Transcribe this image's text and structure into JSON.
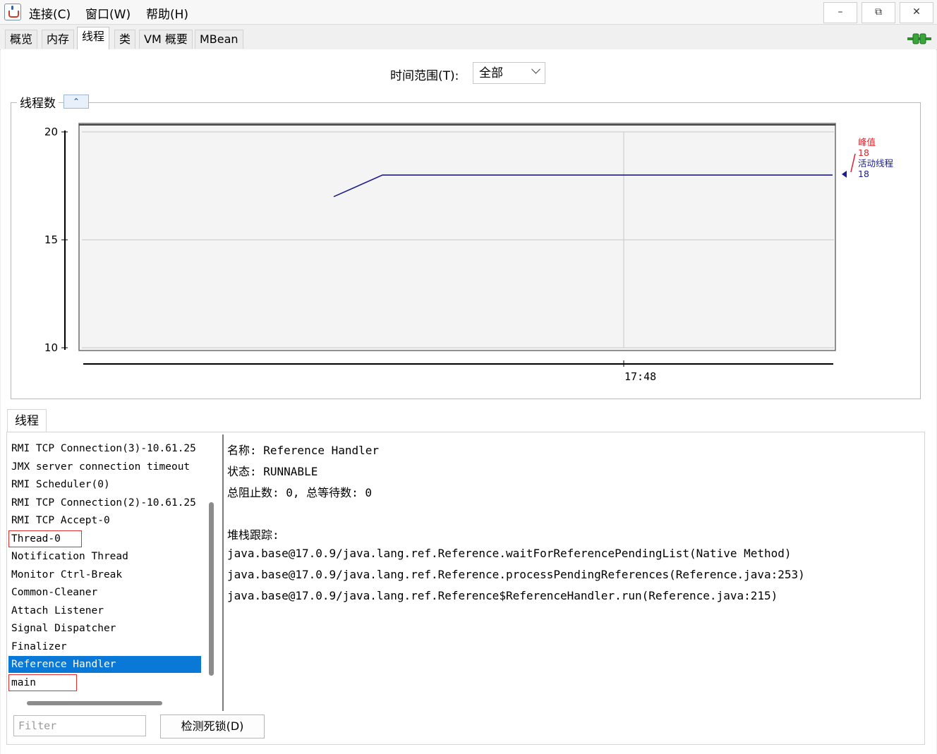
{
  "menu": {
    "connect": "连接(C)",
    "window": "窗口(W)",
    "help": "帮助(H)"
  },
  "window_buttons": {
    "minimize": "–",
    "restore": "⧉",
    "close": "✕"
  },
  "tabs": [
    {
      "label": "概览"
    },
    {
      "label": "内存"
    },
    {
      "label": "线程",
      "active": true
    },
    {
      "label": "类"
    },
    {
      "label": "VM 概要"
    },
    {
      "label": "MBean"
    }
  ],
  "time_range": {
    "label": "时间范围(T):",
    "value": "全部"
  },
  "chart_title": "线程数",
  "collapse_glyph": "⌃",
  "chart_data": {
    "type": "line",
    "y_ticks": [
      "20",
      "15",
      "10"
    ],
    "ylim": [
      10,
      20
    ],
    "x_ticks": [
      "17:48"
    ],
    "series": [
      {
        "name": "活动线程",
        "color": "#1c1c8c",
        "points": [
          [
            0,
            17
          ],
          [
            1,
            18
          ],
          [
            2,
            18
          ],
          [
            3,
            18
          ]
        ]
      }
    ],
    "legend": [
      {
        "label": "峰值",
        "value": "18",
        "color": "#e0202a"
      },
      {
        "label": "活动线程",
        "value": "18",
        "color": "#1c1c8c"
      }
    ]
  },
  "threads_tab_label": "线程",
  "threads": [
    "RMI TCP Connection(3)-10.61.25",
    "JMX server connection timeout",
    "RMI Scheduler(0)",
    "RMI TCP Connection(2)-10.61.25",
    "RMI TCP Accept-0",
    "Thread-0",
    "Notification Thread",
    "Monitor Ctrl-Break",
    "Common-Cleaner",
    "Attach Listener",
    "Signal Dispatcher",
    "Finalizer",
    "Reference Handler",
    "main"
  ],
  "selected_thread": "Reference Handler",
  "details": {
    "name": "名称: Reference Handler",
    "state": "状态: RUNNABLE",
    "counts": "总阻止数: 0, 总等待数: 0",
    "stack_header": "堆栈跟踪:",
    "stack": [
      "java.base@17.0.9/java.lang.ref.Reference.waitForReferencePendingList(Native Method)",
      "java.base@17.0.9/java.lang.ref.Reference.processPendingReferences(Reference.java:253)",
      "java.base@17.0.9/java.lang.ref.Reference$ReferenceHandler.run(Reference.java:215)"
    ]
  },
  "filter_placeholder": "Filter",
  "deadlock_button": "检测死锁(D)"
}
